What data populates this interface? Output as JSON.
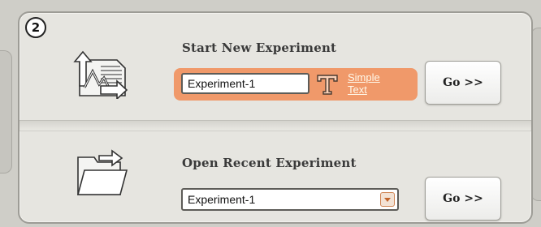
{
  "step_number": "2",
  "new_experiment": {
    "title": "Start New Experiment",
    "name_value": "Experiment-1",
    "text_tool_icon": "text-tool-icon",
    "simple_text_line1": "Simple",
    "simple_text_line2": "Text",
    "go_label": "Go >>",
    "icon": "new-experiment-graph-icon",
    "accent_color": "#f0996a"
  },
  "recent_experiment": {
    "title": "Open Recent Experiment",
    "selected_value": "Experiment-1",
    "go_label": "Go >>",
    "icon": "open-folder-icon"
  }
}
